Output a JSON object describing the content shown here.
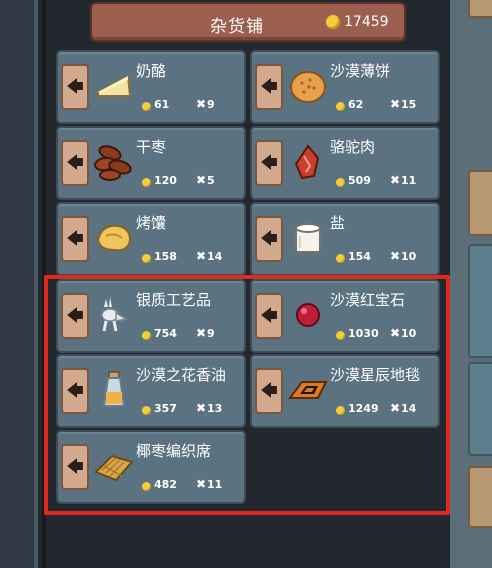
{
  "shop": {
    "title": "杂货铺",
    "gold": "17459"
  },
  "items": [
    {
      "name": "奶酪",
      "price": "61",
      "qty": "9",
      "icon": "cheese-icon"
    },
    {
      "name": "沙漠薄饼",
      "price": "62",
      "qty": "15",
      "icon": "flatbread-icon"
    },
    {
      "name": "干枣",
      "price": "120",
      "qty": "5",
      "icon": "dates-icon"
    },
    {
      "name": "骆驼肉",
      "price": "509",
      "qty": "11",
      "icon": "camel-meat-icon"
    },
    {
      "name": "烤馕",
      "price": "158",
      "qty": "14",
      "icon": "naan-icon"
    },
    {
      "name": "盐",
      "price": "154",
      "qty": "10",
      "icon": "salt-icon"
    },
    {
      "name": "银质工艺品",
      "price": "754",
      "qty": "9",
      "icon": "silver-crafts-icon"
    },
    {
      "name": "沙漠红宝石",
      "price": "1030",
      "qty": "10",
      "icon": "ruby-icon"
    },
    {
      "name": "沙漠之花香油",
      "price": "357",
      "qty": "13",
      "icon": "perfume-oil-icon"
    },
    {
      "name": "沙漠星辰地毯",
      "price": "1249",
      "qty": "14",
      "icon": "carpet-icon"
    },
    {
      "name": "椰枣编织席",
      "price": "482",
      "qty": "11",
      "icon": "palm-mat-icon"
    }
  ],
  "symbols": {
    "arrow": "🡄",
    "times": "✖"
  },
  "colors": {
    "highlight": "#e0281e",
    "card": "#5b7280",
    "title_bar": "#9a5f4f",
    "coin": "#f2cd3a"
  }
}
